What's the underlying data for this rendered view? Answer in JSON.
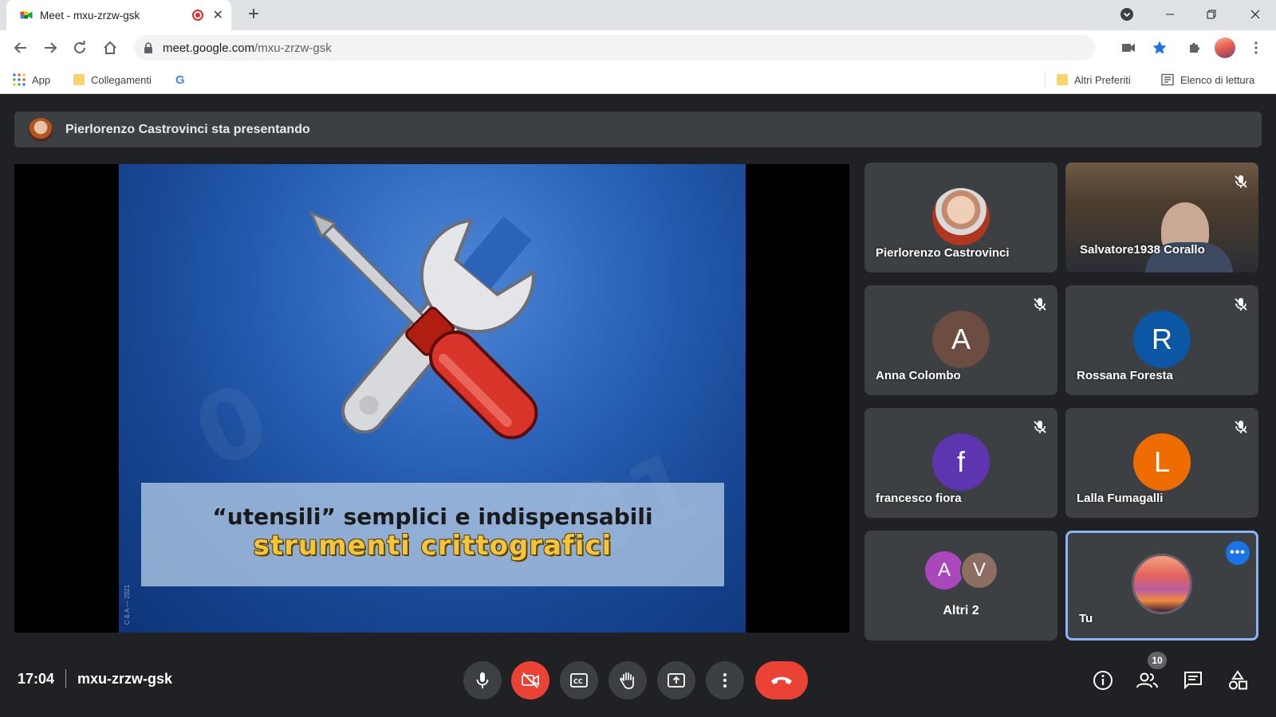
{
  "browser": {
    "tab_title": "Meet - mxu-zrzw-gsk",
    "url_host": "meet.google.com",
    "url_path": "/mxu-zrzw-gsk",
    "bookmarks": {
      "apps": "App",
      "links": "Collegamenti",
      "others": "Altri Preferiti",
      "reading_list": "Elenco di lettura"
    }
  },
  "meet": {
    "presenting_banner": "Pierlorenzo Castrovinci sta presentando",
    "slide": {
      "line1": "“utensili” semplici e indispensabili",
      "line2": "strumenti crittografici",
      "watermark": "C & A — 2021"
    },
    "participants": [
      {
        "name": "Pierlorenzo Castrovinci",
        "type": "photo",
        "muted": false
      },
      {
        "name": "Salvatore1938 Corallo",
        "type": "video",
        "muted": true
      },
      {
        "name": "Anna Colombo",
        "initial": "A",
        "color": "#6d4c41",
        "muted": true
      },
      {
        "name": "Rossana Foresta",
        "initial": "R",
        "color": "#0b57a4",
        "muted": true
      },
      {
        "name": "francesco fiora",
        "initial": "f",
        "color": "#5e35b1",
        "muted": true
      },
      {
        "name": "Lalla Fumagalli",
        "initial": "L",
        "color": "#ef6c00",
        "muted": true
      },
      {
        "name": "Altri 2",
        "initials": [
          "A",
          "V"
        ],
        "colors": [
          "#ab47bc",
          "#8d6e63"
        ]
      },
      {
        "name": "Tu",
        "type": "self"
      }
    ],
    "time": "17:04",
    "meeting_code": "mxu-zrzw-gsk",
    "participants_count": "10"
  }
}
